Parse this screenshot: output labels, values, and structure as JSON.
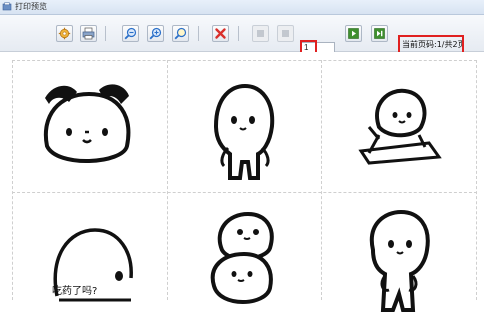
{
  "window": {
    "title": "打印预览"
  },
  "toolbar": {
    "buttons": [
      {
        "name": "settings",
        "icon": "gear-icon"
      },
      {
        "name": "print",
        "icon": "printer-icon"
      },
      {
        "name": "zoom-out",
        "icon": "zoom-out-icon"
      },
      {
        "name": "zoom-in",
        "icon": "zoom-in-icon"
      },
      {
        "name": "fit",
        "icon": "zoom-fit-icon"
      },
      {
        "name": "close",
        "icon": "close-icon"
      },
      {
        "name": "first-page",
        "icon": "first-page-icon"
      },
      {
        "name": "prev-page",
        "icon": "prev-page-icon"
      },
      {
        "name": "next-page",
        "icon": "next-page-icon"
      },
      {
        "name": "last-page",
        "icon": "last-page-icon"
      }
    ],
    "page_input_value": "1",
    "page_indicator": "当前页码:1/共2页"
  },
  "preview": {
    "stickers": [
      {
        "name": "sticker-head-pat",
        "caption": ""
      },
      {
        "name": "sticker-standing",
        "caption": ""
      },
      {
        "name": "sticker-writing",
        "caption": ""
      },
      {
        "name": "sticker-medicine",
        "caption": "吃药了吗?"
      },
      {
        "name": "sticker-stacked",
        "caption": ""
      },
      {
        "name": "sticker-shy",
        "caption": ""
      }
    ]
  },
  "colors": {
    "highlight": "#e02020",
    "accent_blue": "#2a6fc9",
    "close_red": "#d9302c"
  }
}
